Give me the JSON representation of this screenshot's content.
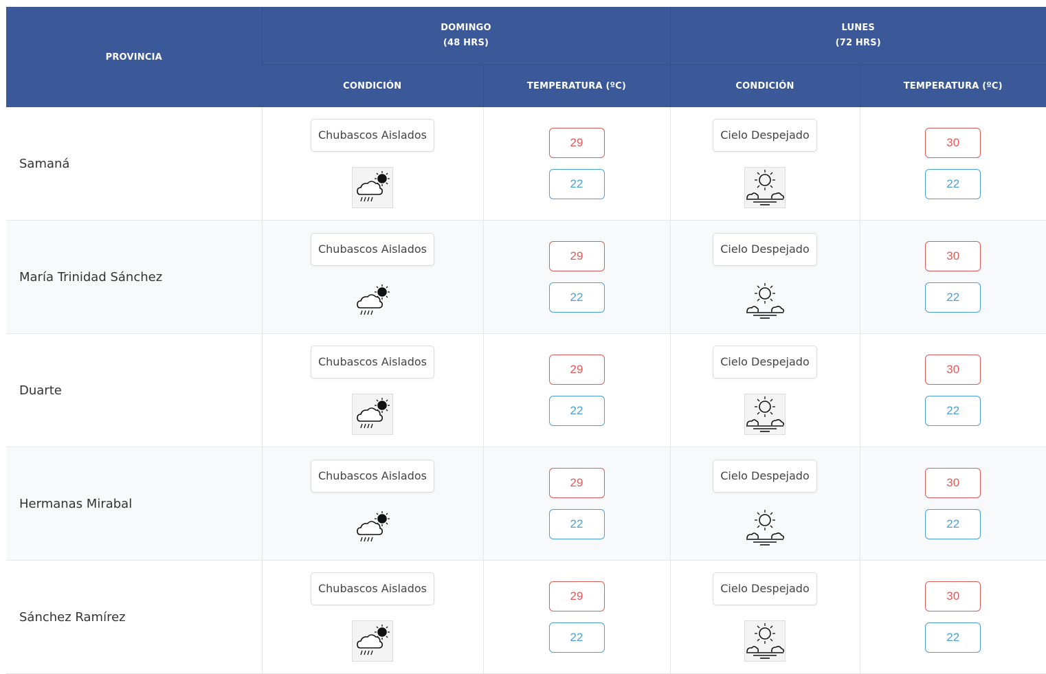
{
  "header": {
    "province_label": "PROVINCIA",
    "days": [
      {
        "name": "DOMINGO",
        "hours": "(48 HRS)"
      },
      {
        "name": "LUNES",
        "hours": "(72 HRS)"
      }
    ],
    "condition_label": "CONDICIÓN",
    "temperature_label": "TEMPERATURA (ºC)"
  },
  "rows": [
    {
      "province": "Samaná",
      "day1": {
        "condition": "Chubascos Aislados",
        "icon": "isolated-showers-icon",
        "max": "29",
        "min": "22"
      },
      "day2": {
        "condition": "Cielo Despejado",
        "icon": "clear-sky-icon",
        "max": "30",
        "min": "22"
      }
    },
    {
      "province": "María Trinidad Sánchez",
      "day1": {
        "condition": "Chubascos Aislados",
        "icon": "isolated-showers-icon",
        "max": "29",
        "min": "22"
      },
      "day2": {
        "condition": "Cielo Despejado",
        "icon": "clear-sky-icon",
        "max": "30",
        "min": "22"
      }
    },
    {
      "province": "Duarte",
      "day1": {
        "condition": "Chubascos Aislados",
        "icon": "isolated-showers-icon",
        "max": "29",
        "min": "22"
      },
      "day2": {
        "condition": "Cielo Despejado",
        "icon": "clear-sky-icon",
        "max": "30",
        "min": "22"
      }
    },
    {
      "province": "Hermanas Mirabal",
      "day1": {
        "condition": "Chubascos Aislados",
        "icon": "isolated-showers-icon",
        "max": "29",
        "min": "22"
      },
      "day2": {
        "condition": "Cielo Despejado",
        "icon": "clear-sky-icon",
        "max": "30",
        "min": "22"
      }
    },
    {
      "province": "Sánchez Ramírez",
      "day1": {
        "condition": "Chubascos Aislados",
        "icon": "isolated-showers-icon",
        "max": "29",
        "min": "22"
      },
      "day2": {
        "condition": "Cielo Despejado",
        "icon": "clear-sky-icon",
        "max": "30",
        "min": "22"
      }
    }
  ],
  "colors": {
    "header_bg": "#3b5998",
    "max_temp": "#e05a5a",
    "min_temp": "#4a9fd8"
  }
}
